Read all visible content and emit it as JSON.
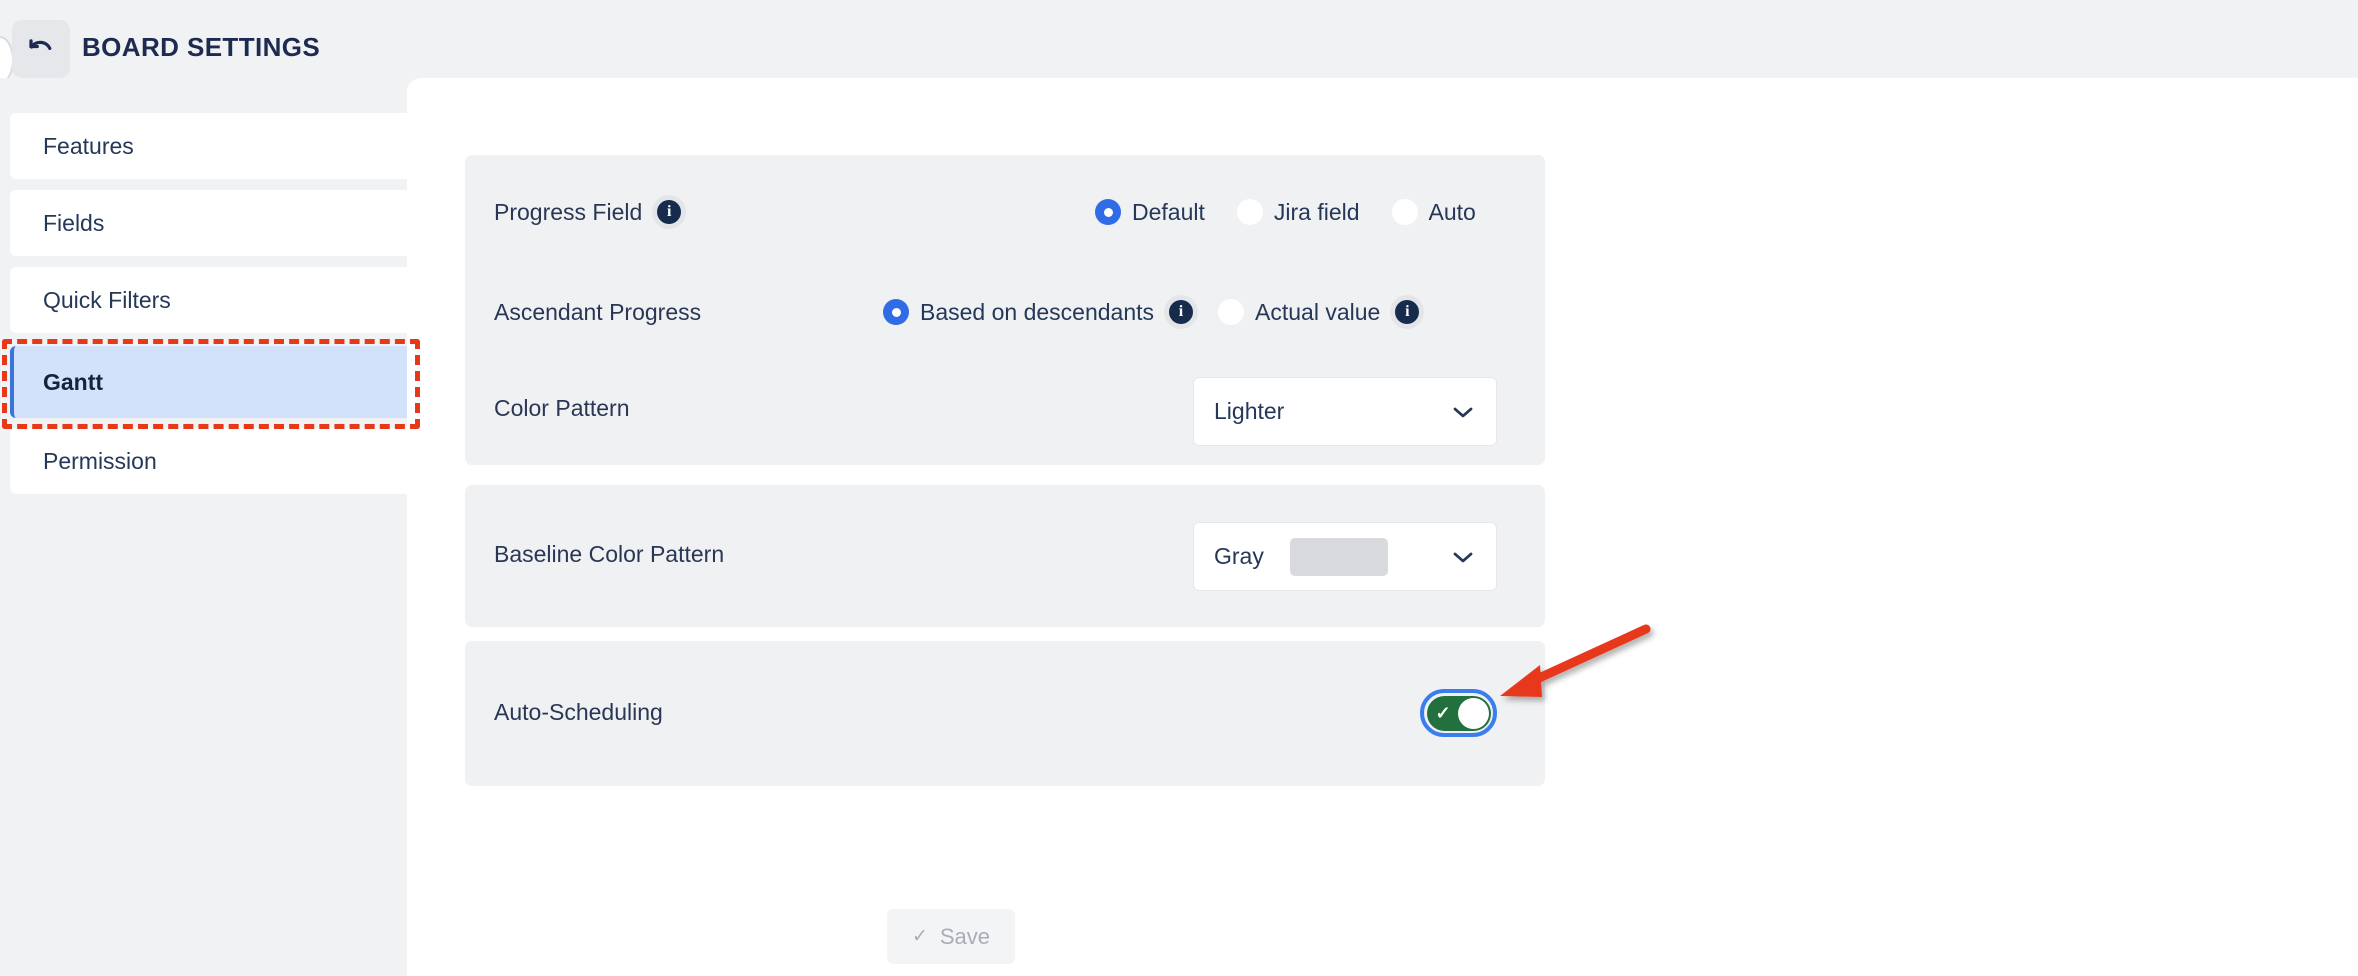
{
  "header": {
    "title": "BOARD SETTINGS",
    "back_icon": "undo-arrow-icon"
  },
  "sidebar": {
    "items": [
      {
        "label": "Features",
        "selected": false
      },
      {
        "label": "Fields",
        "selected": false
      },
      {
        "label": "Quick Filters",
        "selected": false
      },
      {
        "label": "Gantt",
        "selected": true
      },
      {
        "label": "Permission",
        "selected": false
      }
    ]
  },
  "main": {
    "panels": {
      "progress": {
        "progress_field": {
          "label": "Progress Field",
          "has_info": true,
          "options": [
            {
              "label": "Default",
              "selected": true,
              "has_info": false
            },
            {
              "label": "Jira field",
              "selected": false,
              "has_info": false
            },
            {
              "label": "Auto",
              "selected": false,
              "has_info": false
            }
          ]
        },
        "ascendant_progress": {
          "label": "Ascendant Progress",
          "has_info": false,
          "options": [
            {
              "label": "Based on descendants",
              "selected": true,
              "has_info": true
            },
            {
              "label": "Actual value",
              "selected": false,
              "has_info": true
            }
          ]
        },
        "color_pattern": {
          "label": "Color Pattern",
          "value": "Lighter",
          "swatch": false
        }
      },
      "baseline": {
        "baseline_color_pattern": {
          "label": "Baseline Color Pattern",
          "value": "Gray",
          "swatch": true,
          "swatch_color": "#d8dadd"
        }
      },
      "auto": {
        "auto_scheduling": {
          "label": "Auto-Scheduling",
          "enabled": true,
          "check_glyph": "✓"
        }
      }
    },
    "save": {
      "label": "Save",
      "check_glyph": "✓",
      "disabled": true
    }
  },
  "annotations": {
    "highlight_color": "#e8381a",
    "dashed_target": "Gantt",
    "arrow_target": "Auto-Scheduling toggle"
  },
  "colors": {
    "accent_blue": "#2f6ce5",
    "selected_nav_bg": "#d3e2fb",
    "toggle_green": "#22703e",
    "panel_bg": "#f0f1f3",
    "page_bg": "#f1f2f4"
  },
  "glyphs": {
    "chevron_down": "chevron-down-icon",
    "info": "info-icon"
  }
}
